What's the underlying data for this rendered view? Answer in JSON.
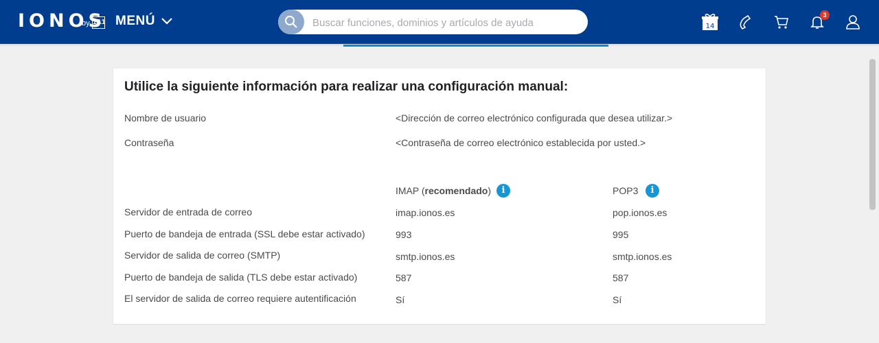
{
  "header": {
    "logo_text": "IONOS",
    "logo_by": "by",
    "logo_1and1": "1&1",
    "menu_label": "MENÚ",
    "search_placeholder": "Buscar funciones, dominios y artículos de ayuda",
    "calendar_day": "14",
    "notification_count": "3"
  },
  "colors": {
    "header_bg": "#003d8f",
    "accent": "#0f8acd",
    "info": "#1497d4",
    "badge": "#e0362c"
  },
  "icons": [
    "gift-calendar-icon",
    "phone-icon",
    "cart-icon",
    "bell-icon",
    "user-icon",
    "search-icon",
    "chevron-down-icon",
    "info-icon"
  ],
  "card": {
    "title": "Utilice la siguiente información para realizar una configuración manual:",
    "username_label": "Nombre de usuario",
    "username_value": "<Dirección de correo electrónico configurada que desea utilizar.>",
    "password_label": "Contraseña",
    "password_value": "<Contraseña de correo electrónico establecida por usted.>",
    "imap_header_prefix": "IMAP (",
    "imap_header_bold": "recomendado",
    "imap_header_suffix": ")",
    "pop3_header": "POP3",
    "rows": [
      {
        "label": "Servidor de entrada de correo",
        "imap": "imap.ionos.es",
        "pop3": "pop.ionos.es"
      },
      {
        "label": "Puerto de bandeja de entrada (SSL debe estar activado)",
        "imap": "993",
        "pop3": "995"
      },
      {
        "label": "Servidor de salida de correo (SMTP)",
        "imap": "smtp.ionos.es",
        "pop3": "smtp.ionos.es"
      },
      {
        "label": "Puerto de bandeja de salida (TLS debe estar activado)",
        "imap": "587",
        "pop3": "587"
      },
      {
        "label": "El servidor de salida de correo requiere autentificación",
        "imap": "Sí",
        "pop3": "Sí"
      }
    ]
  }
}
